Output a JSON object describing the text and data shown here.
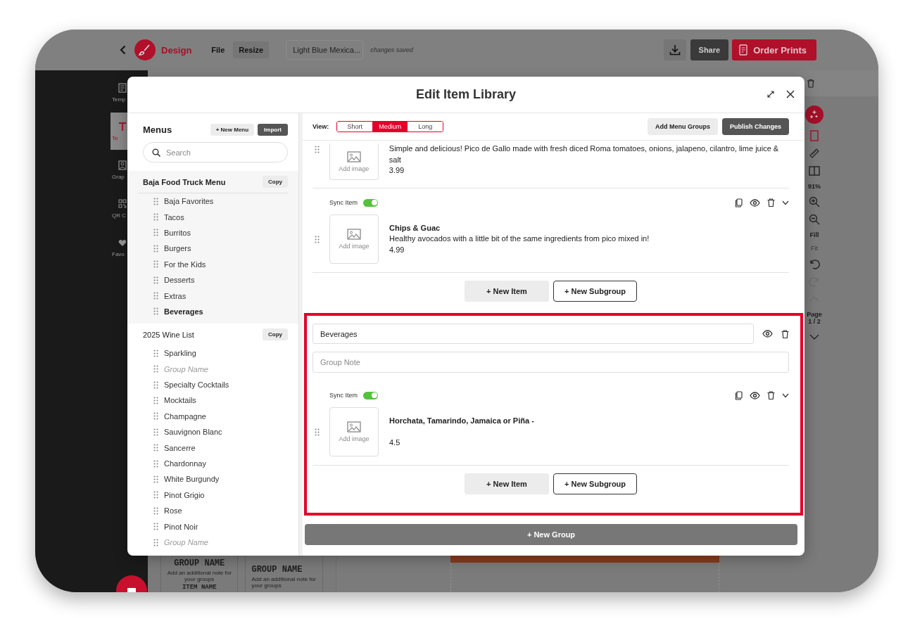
{
  "top_bar": {
    "brand": "Design",
    "menu": [
      {
        "label": "File",
        "kind": "link"
      },
      {
        "label": "Resize",
        "kind": "button"
      }
    ],
    "document_title": "Light Blue Mexica...",
    "save_status": "changes saved",
    "share": "Share",
    "order": "Order Prints"
  },
  "tools": [
    {
      "label": "Temp",
      "selected": false
    },
    {
      "label": "Te",
      "selected": true
    },
    {
      "label": "Grap",
      "selected": false
    },
    {
      "label": "QR C",
      "selected": false
    },
    {
      "label": "Favo",
      "selected": false
    }
  ],
  "templates": [
    {
      "title": "GROUP NAME",
      "note": "Add an additional note for your groups",
      "item": "ITEM NAME"
    },
    {
      "title": "GROUP NAME",
      "note": "Add an additional note for your groups"
    }
  ],
  "view_controls": {
    "zoom": "91%",
    "fill": "Fill",
    "fit": "Fit",
    "page_label": "Page",
    "page": "1 / 2"
  },
  "dialog": {
    "title": "Edit Item Library",
    "menus_heading": "Menus",
    "new_menu": "+ New Menu",
    "import": "Import",
    "search": {
      "placeholder": "Search"
    },
    "menus": [
      {
        "name": "Baja Food Truck Menu",
        "selected": true,
        "copy": "Copy",
        "groups": [
          {
            "name": "Baja Favorites",
            "kind": "group",
            "selected": false
          },
          {
            "name": "Tacos",
            "kind": "group",
            "selected": false
          },
          {
            "name": "Burritos",
            "kind": "group",
            "selected": false
          },
          {
            "name": "Burgers",
            "kind": "group",
            "selected": false
          },
          {
            "name": "For the Kids",
            "kind": "group",
            "selected": false
          },
          {
            "name": "Desserts",
            "kind": "group",
            "selected": false
          },
          {
            "name": "Extras",
            "kind": "group",
            "selected": false
          },
          {
            "name": "Beverages",
            "kind": "group",
            "selected": true
          }
        ]
      },
      {
        "name": "2025 Wine List",
        "selected": false,
        "copy": "Copy",
        "groups": [
          {
            "name": "Sparkling",
            "kind": "group",
            "selected": false
          },
          {
            "name": "Group Name",
            "kind": "placeholder",
            "selected": false
          },
          {
            "name": "Specialty Cocktails",
            "kind": "group",
            "selected": false
          },
          {
            "name": "Mocktails",
            "kind": "group",
            "selected": false
          },
          {
            "name": "Champagne",
            "kind": "group",
            "selected": false
          },
          {
            "name": "Sauvignon Blanc",
            "kind": "group",
            "selected": false
          },
          {
            "name": "Sancerre",
            "kind": "group",
            "selected": false
          },
          {
            "name": "Chardonnay",
            "kind": "group",
            "selected": false
          },
          {
            "name": "White Burgundy",
            "kind": "group",
            "selected": false
          },
          {
            "name": "Pinot Grigio",
            "kind": "group",
            "selected": false
          },
          {
            "name": "Rose",
            "kind": "group",
            "selected": false
          },
          {
            "name": "Pinot Noir",
            "kind": "group",
            "selected": false
          },
          {
            "name": "Group Name",
            "kind": "placeholder",
            "selected": false
          }
        ]
      }
    ],
    "view_label": "View:",
    "views": [
      {
        "label": "Short",
        "selected": false
      },
      {
        "label": "Medium",
        "selected": true
      },
      {
        "label": "Long",
        "selected": false
      }
    ],
    "add_groups": "Add Menu Groups",
    "publish": "Publish Changes",
    "groups": [
      {
        "highlighted": false,
        "items": [
          {
            "kind": "cut",
            "image_label": "Add image",
            "description": "Simple and delicious! Pico de Gallo made with fresh diced Roma tomatoes, onions, jalapeno, cilantro, lime juice & salt",
            "price": "3.99"
          },
          {
            "kind": "full",
            "sync_label": "Sync Item",
            "synced": true,
            "image_label": "Add image",
            "name": "Chips & Guac",
            "description": "Healthy avocados with a little bit of the same ingredients from pico mixed in!",
            "price": "4.99"
          }
        ],
        "new_item": "+ New Item",
        "new_subgroup": "+ New Subgroup"
      },
      {
        "highlighted": true,
        "name": "Beverages",
        "note": {
          "placeholder": "Group Note"
        },
        "items": [
          {
            "kind": "full",
            "sync_label": "Sync Item",
            "synced": true,
            "image_label": "Add image",
            "name": "Horchata, Tamarindo, Jamaica or Piña -",
            "price": "4.5"
          }
        ],
        "new_item": "+ New Item",
        "new_subgroup": "+ New Subgroup"
      }
    ],
    "new_group": "+ New Group"
  }
}
